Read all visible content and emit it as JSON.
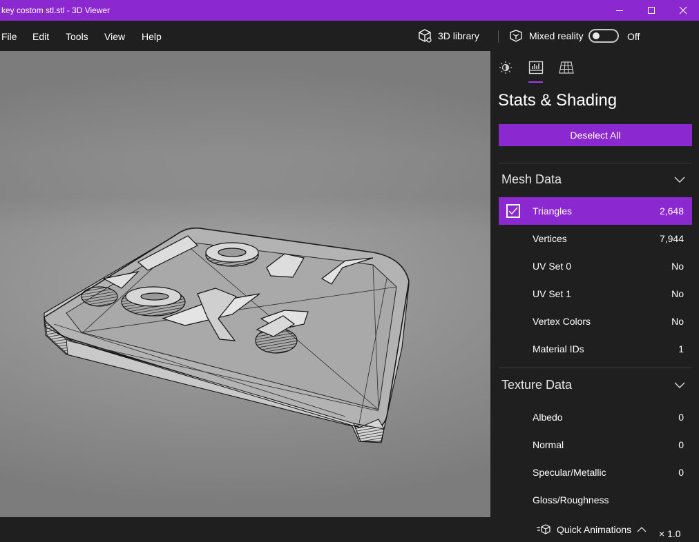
{
  "window": {
    "title": "key costom stl.stl - 3D Viewer",
    "accent_color": "#8c28cf"
  },
  "menu": {
    "items": [
      "File",
      "Edit",
      "Tools",
      "View",
      "Help"
    ],
    "library_label": "3D library",
    "mixed_reality_label": "Mixed reality",
    "mixed_reality_state": "Off"
  },
  "panel": {
    "tabs": [
      "lighting-icon",
      "stats-icon",
      "grid-icon"
    ],
    "active_tab": "stats-icon",
    "title": "Stats & Shading",
    "deselect_label": "Deselect All",
    "mesh": {
      "heading": "Mesh Data",
      "rows": [
        {
          "label": "Triangles",
          "value": "2,648",
          "checked": true
        },
        {
          "label": "Vertices",
          "value": "7,944"
        },
        {
          "label": "UV Set 0",
          "value": "No"
        },
        {
          "label": "UV Set 1",
          "value": "No"
        },
        {
          "label": "Vertex Colors",
          "value": "No"
        },
        {
          "label": "Material IDs",
          "value": "1"
        }
      ]
    },
    "texture": {
      "heading": "Texture Data",
      "rows": [
        {
          "label": "Albedo",
          "value": "0"
        },
        {
          "label": "Normal",
          "value": "0"
        },
        {
          "label": "Specular/Metallic",
          "value": "0"
        },
        {
          "label": "Gloss/Roughness",
          "value": ""
        }
      ]
    }
  },
  "bottom": {
    "quick_animations_label": "Quick Animations",
    "speed": "× 1.0"
  }
}
